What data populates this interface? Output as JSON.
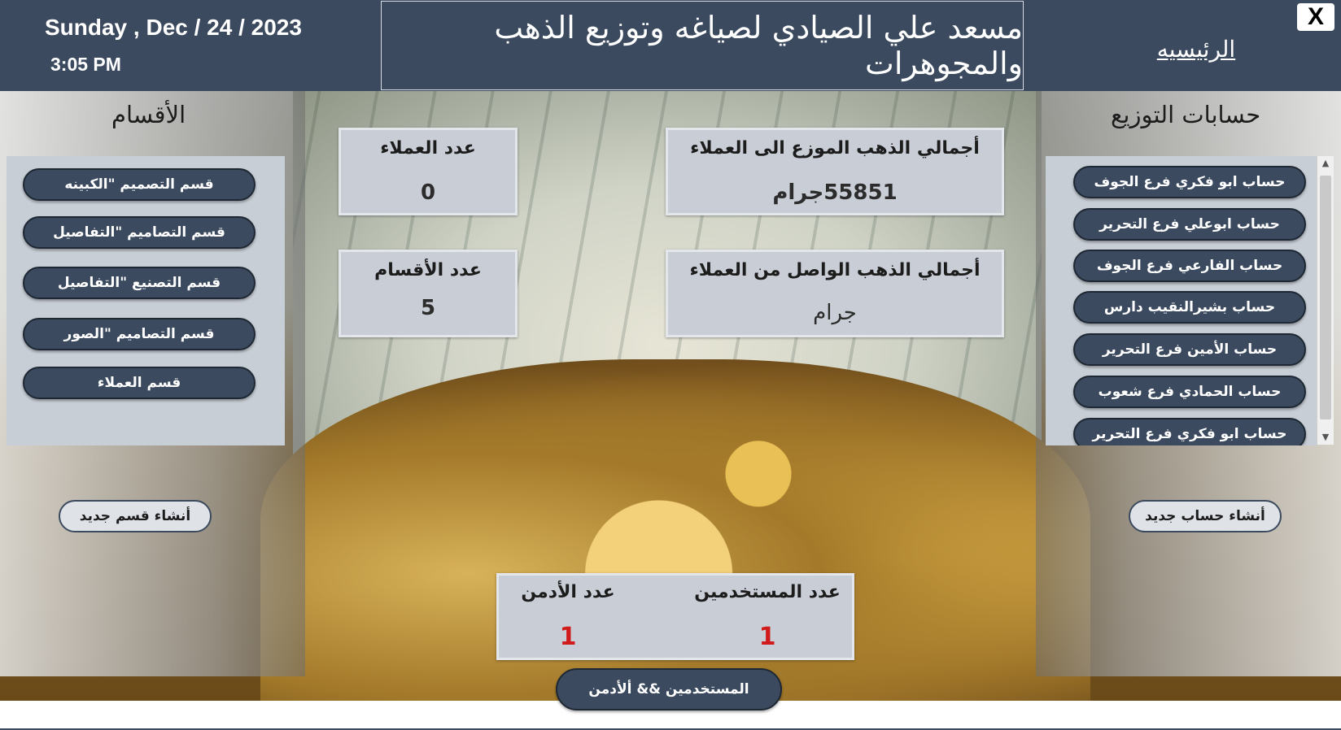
{
  "header": {
    "date": "Sunday , Dec / 24 / 2023",
    "time": "3:05 PM",
    "title": "مسعد علي الصيادي لصياغه وتوزيع الذهب والمجوهرات",
    "home_link": "الرئيسيه",
    "close_label": "X"
  },
  "sections": {
    "title": "الأقسام",
    "items": [
      "قسم التصميم \"الكبينه",
      "قسم التصاميم \"التفاصيل",
      "قسم التصنيع \"التفاصيل",
      "قسم التصاميم \"الصور",
      "قسم العملاء"
    ],
    "new_button": "أنشاء قسم جديد"
  },
  "accounts": {
    "title": "حسابات التوزيع",
    "items": [
      "حساب ابو فكري فرع الجوف",
      "حساب ابوعلي فرع التحرير",
      "حساب الفارعي فرع الجوف",
      "حساب بشيرالنقيب دارس",
      "حساب الأمين فرع التحرير",
      "حساب الحمادي فرع شعوب",
      "حساب ابو فكري فرع التحرير"
    ],
    "new_button": "أنشاء حساب جديد"
  },
  "stats": {
    "clients_label": "عدد العملاء",
    "clients_value": "0",
    "sections_label": "عدد الأقسام",
    "sections_value": "5",
    "gold_out_label": "أجمالي الذهب الموزع الى العملاء",
    "gold_out_value": "55851جرام",
    "gold_in_label": "أجمالي الذهب الواصل من العملاء",
    "gold_in_value": "جرام",
    "users_label": "عدد المستخدمين",
    "users_value": "1",
    "admins_label": "عدد الأدمن",
    "admins_value": "1",
    "count_color": "#d11a1a"
  },
  "footer": {
    "users_admin_button": "المستخدمين && ألأدمن"
  }
}
